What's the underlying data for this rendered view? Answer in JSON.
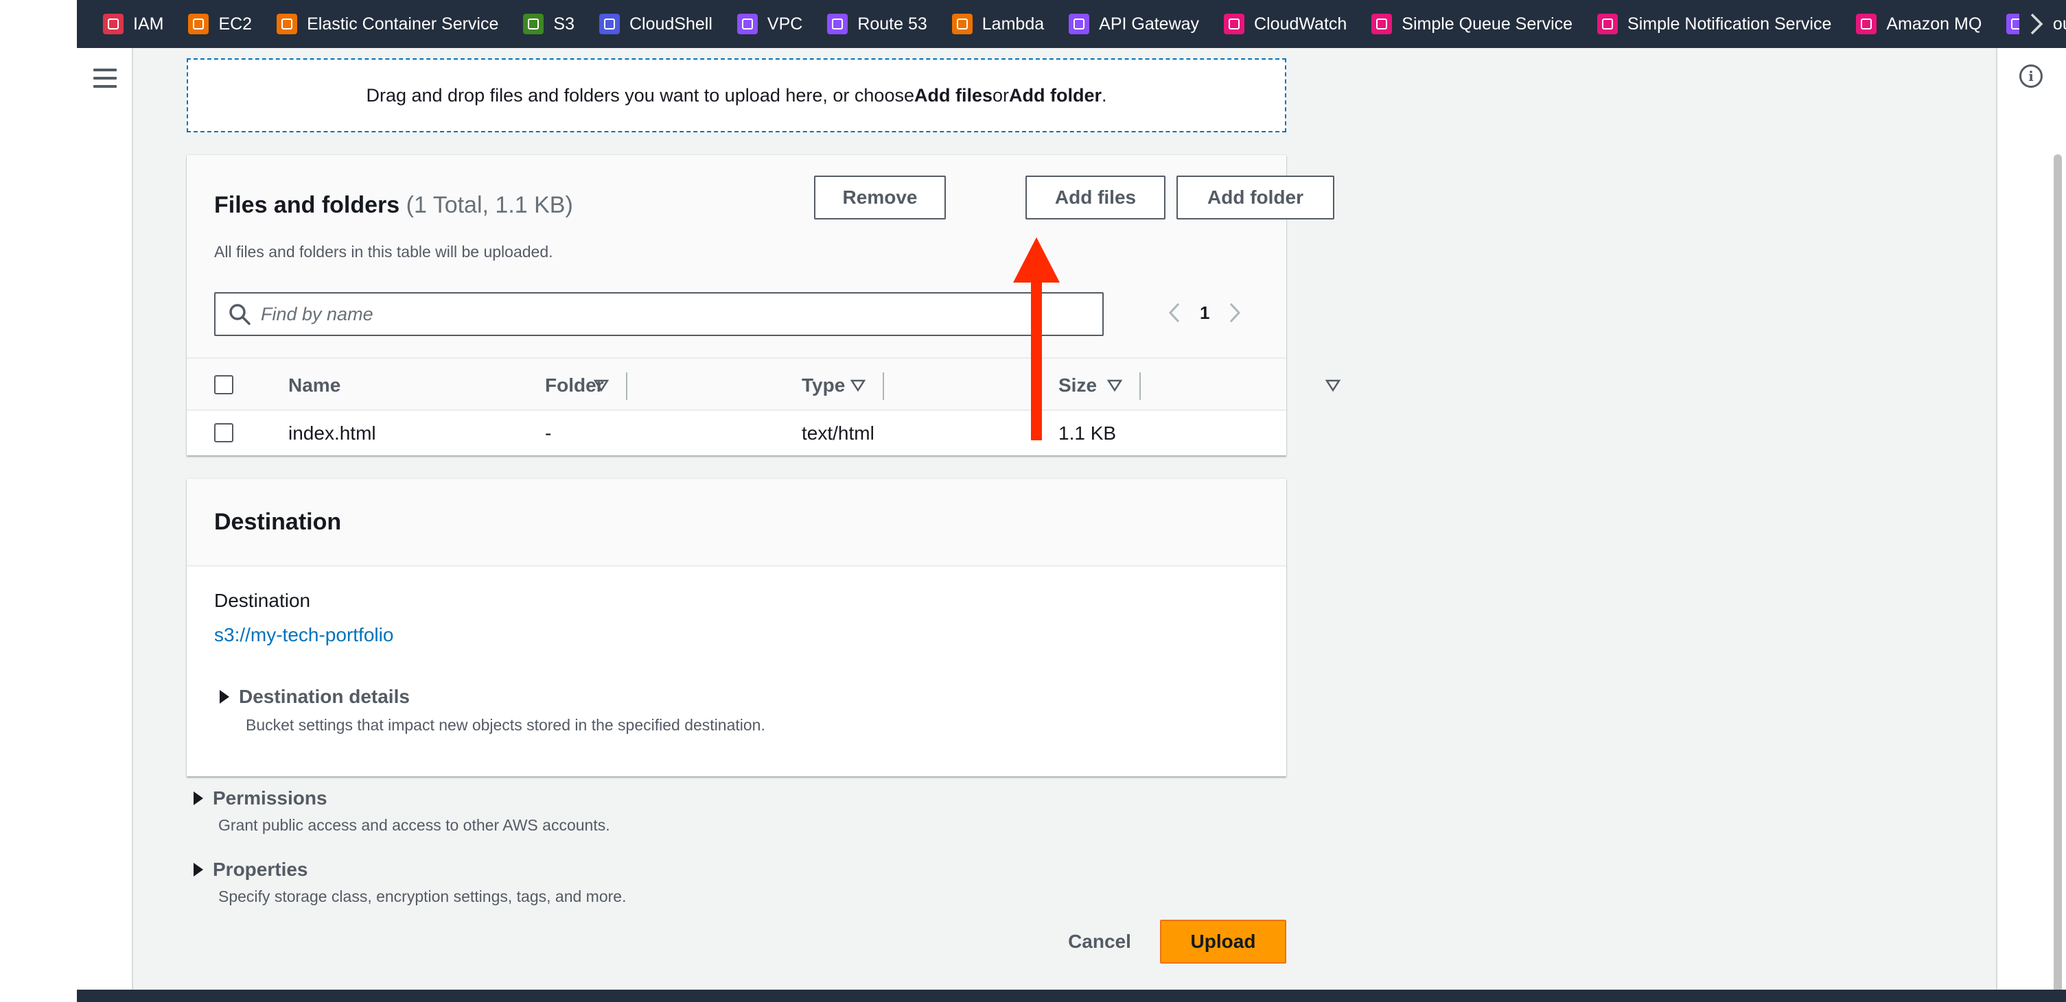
{
  "favorites": [
    {
      "label": "IAM",
      "icon": "iam-icon",
      "color": "#dd344c"
    },
    {
      "label": "EC2",
      "icon": "ec2-icon",
      "color": "#ed7100"
    },
    {
      "label": "Elastic Container Service",
      "icon": "ecs-icon",
      "color": "#ed7100"
    },
    {
      "label": "S3",
      "icon": "s3-icon",
      "color": "#3f8624"
    },
    {
      "label": "CloudShell",
      "icon": "cloudshell-icon",
      "color": "#4d5ae0"
    },
    {
      "label": "VPC",
      "icon": "vpc-icon",
      "color": "#8c4fff"
    },
    {
      "label": "Route 53",
      "icon": "route53-icon",
      "color": "#8c4fff"
    },
    {
      "label": "Lambda",
      "icon": "lambda-icon",
      "color": "#ed7100"
    },
    {
      "label": "API Gateway",
      "icon": "api-gateway-icon",
      "color": "#8c4fff"
    },
    {
      "label": "CloudWatch",
      "icon": "cloudwatch-icon",
      "color": "#e7157b"
    },
    {
      "label": "Simple Queue Service",
      "icon": "sqs-icon",
      "color": "#e7157b"
    },
    {
      "label": "Simple Notification Service",
      "icon": "sns-icon",
      "color": "#e7157b"
    },
    {
      "label": "Amazon MQ",
      "icon": "amazon-mq-icon",
      "color": "#e7157b"
    },
    {
      "label": "Cloud",
      "icon": "cloud-service-icon",
      "color": "#8c4fff"
    }
  ],
  "dropzone": {
    "prefix": "Drag and drop files and folders you want to upload here, or choose ",
    "add_files": "Add files",
    "or": " or ",
    "add_folder": "Add folder",
    "suffix": "."
  },
  "files": {
    "title": "Files and folders",
    "count": "(1 Total, 1.1 KB)",
    "description": "All files and folders in this table will be uploaded.",
    "remove_label": "Remove",
    "add_files_label": "Add files",
    "add_folder_label": "Add folder",
    "search_placeholder": "Find by name",
    "page": "1",
    "columns": [
      "Name",
      "Folder",
      "Type",
      "Size"
    ],
    "rows": [
      {
        "name": "index.html",
        "folder": "-",
        "type": "text/html",
        "size": "1.1 KB"
      }
    ]
  },
  "destination": {
    "title": "Destination",
    "label": "Destination",
    "link": "s3://my-tech-portfolio",
    "details_title": "Destination details",
    "details_desc": "Bucket settings that impact new objects stored in the specified destination."
  },
  "permissions": {
    "title": "Permissions",
    "desc": "Grant public access and access to other AWS accounts."
  },
  "properties": {
    "title": "Properties",
    "desc": "Specify storage class, encryption settings, tags, and more."
  },
  "actions": {
    "cancel_label": "Cancel",
    "upload_label": "Upload"
  },
  "colors": {
    "accent": "#ff9900",
    "link": "#0073bb",
    "header_bg": "#232f3e",
    "annotation_arrow": "#ff2a00"
  }
}
